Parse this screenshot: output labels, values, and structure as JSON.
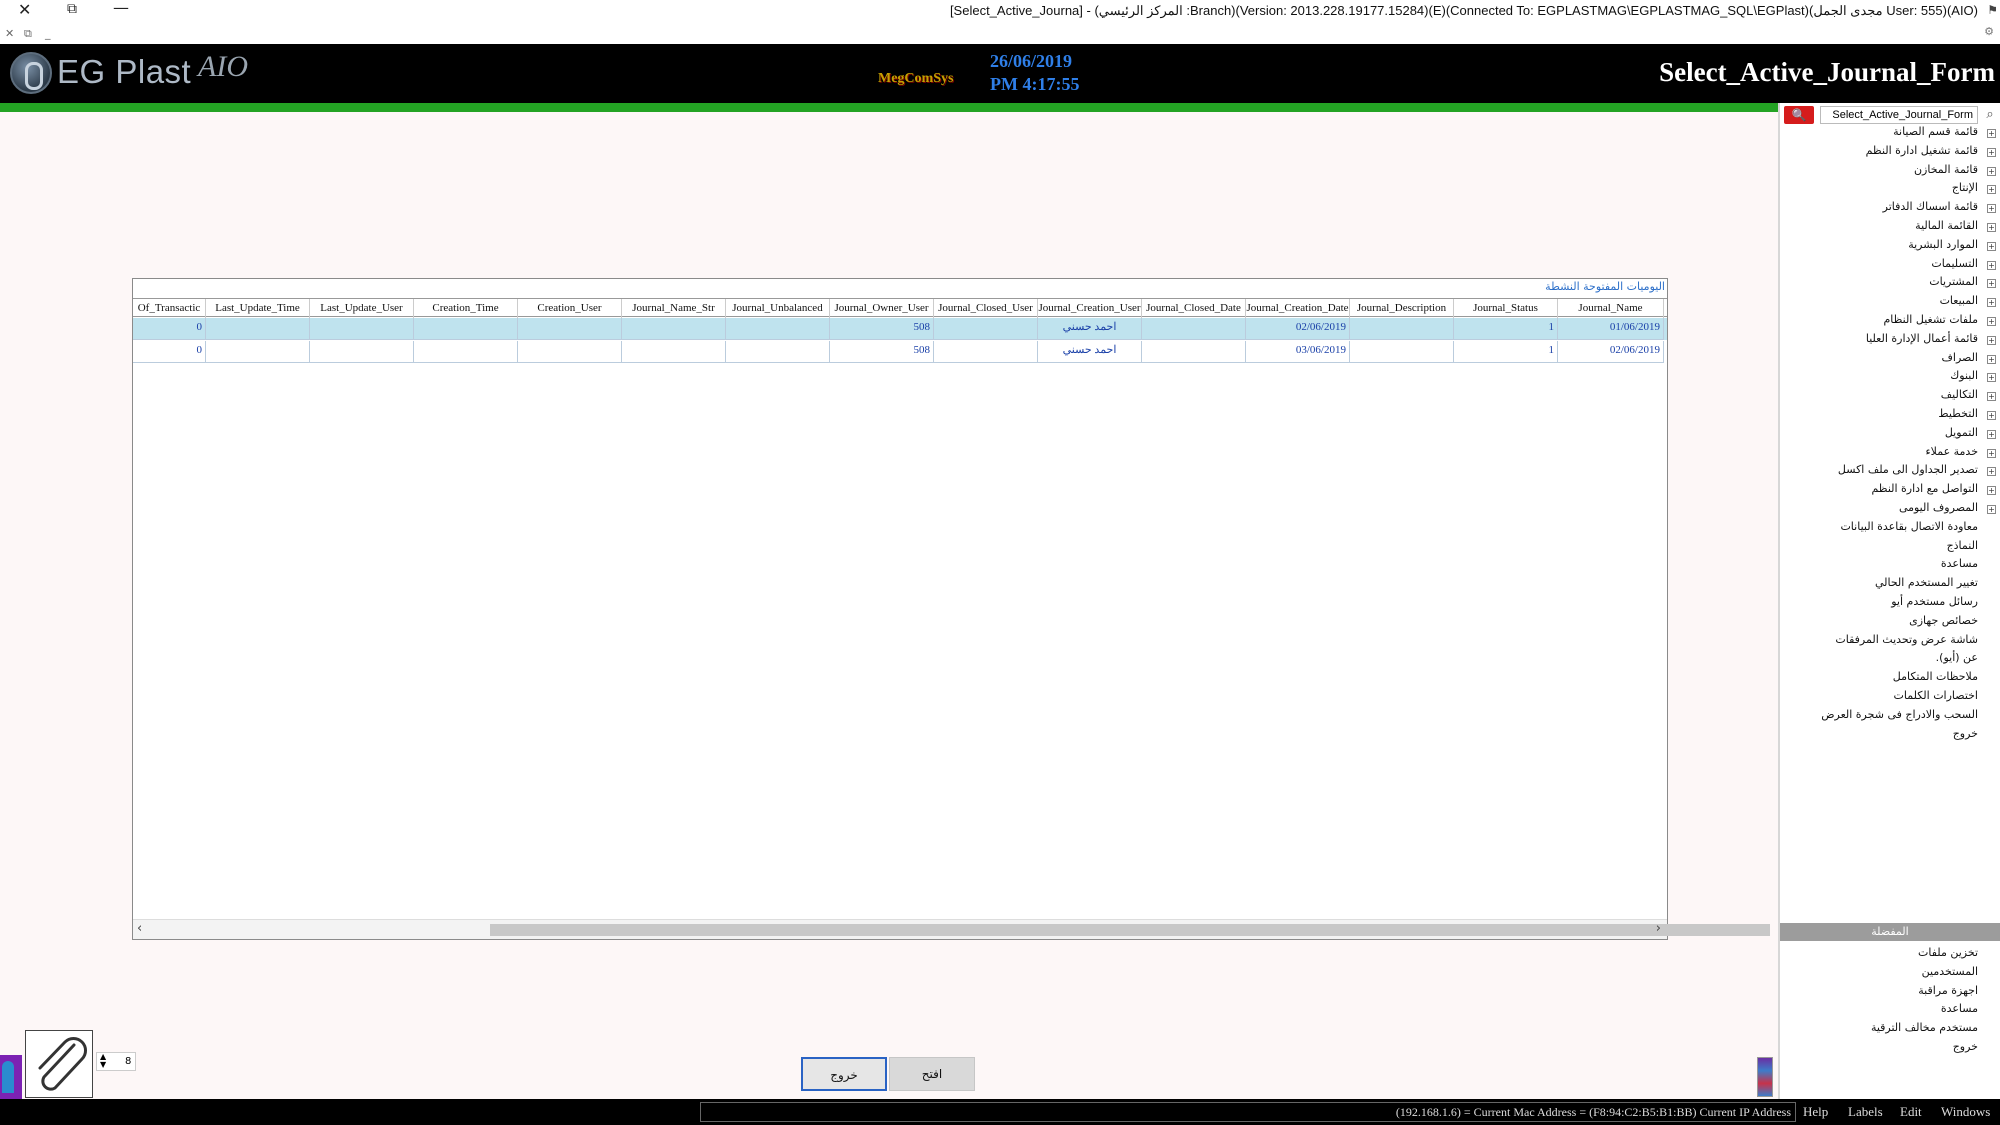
{
  "window": {
    "title": "[Select_Active_Journa] - (المركز الرئيسي :Branch)(Version: 2013.228.19177.15284)(E)(Connected To: EGPLASTMAG\\EGPLASTMAG_SQL\\EGPlast)(مجدى الجمل User: 555)(AIO)"
  },
  "header": {
    "app_name": "EG Plast",
    "app_suffix": "AIO",
    "brand": "MegComSys",
    "date": "26/06/2019",
    "time": "PM 4:17:55",
    "form_title": "Select_Active_Journal_Form"
  },
  "search": {
    "value": "Select_Active_Journal_Form"
  },
  "tree": {
    "items": [
      {
        "label": "قائمة قسم الصيانة",
        "expandable": true
      },
      {
        "label": "قائمة تشغيل ادارة النظم",
        "expandable": true
      },
      {
        "label": "قائمة المخازن",
        "expandable": true
      },
      {
        "label": "الإنتاج",
        "expandable": true
      },
      {
        "label": "قائمة اسساك الدفاتر",
        "expandable": true
      },
      {
        "label": "القائمة المالية",
        "expandable": true
      },
      {
        "label": "الموارد البشرية",
        "expandable": true
      },
      {
        "label": "التسليمات",
        "expandable": true
      },
      {
        "label": "المشتريات",
        "expandable": true
      },
      {
        "label": "المبيعات",
        "expandable": true
      },
      {
        "label": "ملفات تشغيل النظام",
        "expandable": true
      },
      {
        "label": "قائمة أعمال الإدارة العليا",
        "expandable": true
      },
      {
        "label": "الصراف",
        "expandable": true
      },
      {
        "label": "البنوك",
        "expandable": true
      },
      {
        "label": "التكاليف",
        "expandable": true
      },
      {
        "label": "التخطيط",
        "expandable": true
      },
      {
        "label": "التمويل",
        "expandable": true
      },
      {
        "label": "خدمة عملاء",
        "expandable": true
      },
      {
        "label": "تصدير الجداول الى ملف اكسل",
        "expandable": true
      },
      {
        "label": "التواصل مع ادارة النظم",
        "expandable": true
      },
      {
        "label": "المصروف اليومى",
        "expandable": true
      },
      {
        "label": "معاودة الاتصال بقاعدة البيانات",
        "expandable": false
      },
      {
        "label": "النماذج",
        "expandable": false
      },
      {
        "label": "مساعدة",
        "expandable": false
      },
      {
        "label": "تغيير المستخدم الحالي",
        "expandable": false
      },
      {
        "label": "رسائل مستخدم أيو",
        "expandable": false
      },
      {
        "label": "خصائص جهازى",
        "expandable": false
      },
      {
        "label": "شاشة عرض وتحديث المرفقات",
        "expandable": false
      },
      {
        "label": "عن (أيو).",
        "expandable": false
      },
      {
        "label": "ملاحظات المتكامل",
        "expandable": false
      },
      {
        "label": "اختصارات الكلمات",
        "expandable": false
      },
      {
        "label": "السحب والادراج فى شجرة العرض",
        "expandable": false
      },
      {
        "label": "خروج",
        "expandable": false
      }
    ],
    "section_title": "المفضلة",
    "section_items": [
      "تخزين ملفات",
      "المستخدمين",
      "اجهزة مراقبة",
      "مساعدة",
      "مستخدم مخالف الترقية",
      "خروج"
    ]
  },
  "grid": {
    "caption": "اليوميات المفتوحة النشطة",
    "columns": [
      "Of_Transactic",
      "Last_Update_Time",
      "Last_Update_User",
      "Creation_Time",
      "Creation_User",
      "Journal_Name_Str",
      "Journal_Unbalanced",
      "Journal_Owner_User",
      "Journal_Closed_User",
      "Journal_Creation_User",
      "Journal_Closed_Date",
      "Journal_Creation_Date",
      "Journal_Description",
      "Journal_Status",
      "Journal_Name"
    ],
    "rows": [
      {
        "of_transactions": "0",
        "owner_user": "508",
        "creation_user": "احمد حسني",
        "creation_date": "02/06/2019",
        "status": "1",
        "name": "01/06/2019"
      },
      {
        "of_transactions": "0",
        "owner_user": "508",
        "creation_user": "احمد حسني",
        "creation_date": "03/06/2019",
        "status": "1",
        "name": "02/06/2019"
      }
    ]
  },
  "buttons": {
    "exit": "خروج",
    "open": "افتح"
  },
  "attachments": {
    "count": "8"
  },
  "statusbar": {
    "ip_text": "(192.168.1.6) = Current Mac Address = (F8:94:C2:B5:B1:BB) Current IP Address",
    "menu": [
      "Help",
      "Labels",
      "Edit",
      "Windows"
    ]
  }
}
